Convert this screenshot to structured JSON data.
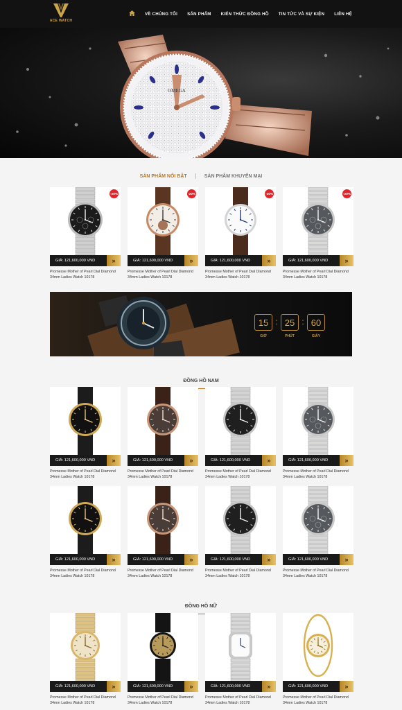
{
  "brand": {
    "name": "ACE WATCH",
    "accent": "#c9a54a"
  },
  "nav": {
    "home_icon": "home-icon",
    "items": [
      "VỀ CHÚNG TÔI",
      "SẢN PHẨM",
      "KIẾN THỨC ĐỒNG HỒ",
      "TIN TỨC VÀ SỰ KIỆN",
      "LIÊN HỆ"
    ]
  },
  "tabs": {
    "featured": "SẢN PHẨM NỔI BẬT",
    "promo": "SẢN PHẨM KHUYẾN MẠI"
  },
  "product_name": "Promesse Mother of Pearl Dial Diamond 34mm Ladies Watch 10178",
  "price_label": "GIÁ: 121,600,000 VND",
  "discount": "-20%",
  "countdown": {
    "hours": "15",
    "minutes": "25",
    "seconds": "60",
    "hours_label": "GIỜ",
    "minutes_label": "PHÚT",
    "seconds_label": "GIÂY"
  },
  "sections": {
    "men": "ĐỒNG HỒ NAM",
    "women": "ĐỒNG HỒ NỮ"
  },
  "featured_products": [
    {
      "style": "chrono-black",
      "badge": true
    },
    {
      "style": "rose-skeleton",
      "badge": true
    },
    {
      "style": "white-leather",
      "badge": true
    },
    {
      "style": "silver-chrono",
      "badge": true
    }
  ],
  "men_products_row1": [
    {
      "style": "gold-black-leather"
    },
    {
      "style": "rose-brown-leather"
    },
    {
      "style": "silver-black-steel"
    },
    {
      "style": "silver-chrono"
    }
  ],
  "men_products_row2": [
    {
      "style": "gold-black-leather"
    },
    {
      "style": "rose-brown-leather"
    },
    {
      "style": "silver-black-steel"
    },
    {
      "style": "silver-chrono"
    }
  ],
  "women_products": [
    {
      "style": "ladies-gold"
    },
    {
      "style": "ladies-black-gold"
    },
    {
      "style": "ladies-tonneau"
    },
    {
      "style": "ladies-gold-bangle"
    }
  ]
}
